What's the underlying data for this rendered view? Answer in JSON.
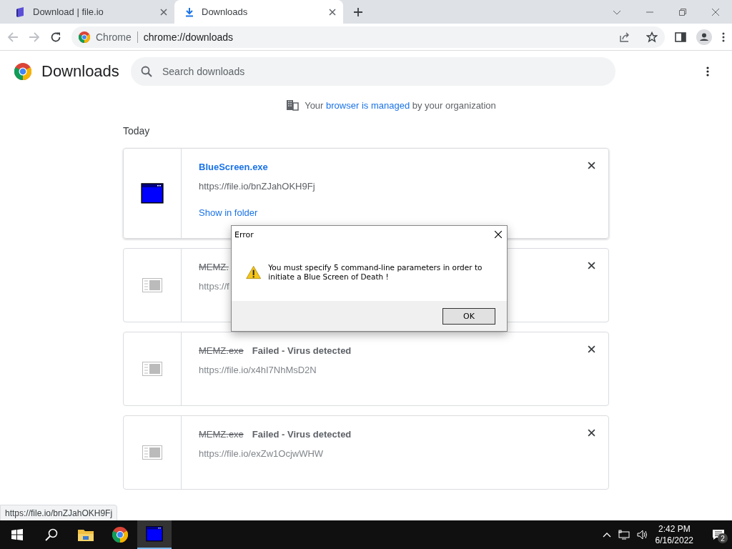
{
  "tabs": [
    {
      "label": "Download | file.io",
      "selected": false
    },
    {
      "label": "Downloads",
      "selected": true
    }
  ],
  "address_bar": {
    "site": "Chrome",
    "url": "chrome://downloads"
  },
  "page": {
    "title": "Downloads",
    "search": {
      "placeholder": "Search downloads"
    },
    "managed_link": "browser is managed",
    "managed_before": "Your",
    "managed_after": "by your organization"
  },
  "section": "Today",
  "downloads": [
    {
      "kind": "done",
      "name": "BlueScreen.exe",
      "url": "https://file.io/bnZJahOKH9Fj",
      "action": "Show in folder"
    },
    {
      "kind": "failed",
      "name": "MEMZ.",
      "url": "https://f"
    },
    {
      "kind": "failed",
      "name": "MEMZ.exe",
      "status": "Failed - Virus detected",
      "url": "https://file.io/x4hI7NhMsD2N"
    },
    {
      "kind": "failed",
      "name": "MEMZ.exe",
      "status": "Failed - Virus detected",
      "url": "https://file.io/exZw1OcjwWHW"
    }
  ],
  "dialog": {
    "title": "Error",
    "message": "You must specify 5 command-line parameters in order to initiate a Blue Screen of Death !",
    "button": "OK"
  },
  "status_link": "https://file.io/bnZJahOKH9Fj",
  "taskbar": {
    "time": "2:42 PM",
    "date": "6/16/2022",
    "notifications": "2"
  }
}
